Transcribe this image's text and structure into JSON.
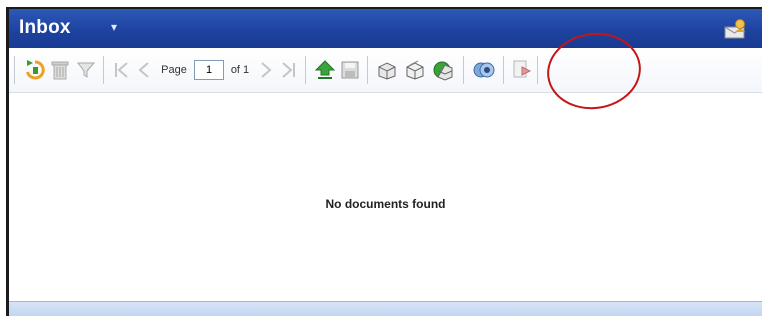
{
  "header": {
    "title": "Inbox",
    "title_caret": "▾",
    "title_icon": "envelope-user-icon"
  },
  "toolbar": {
    "page_label": "Page",
    "page_value": "1",
    "of_label": "of 1",
    "icons": [
      "refresh-icon",
      "delete-icon",
      "filter-icon",
      "first-page-icon",
      "previous-page-icon",
      "next-page-icon",
      "last-page-icon",
      "upload-icon",
      "save-icon",
      "package-icon",
      "package-alt-icon",
      "package-green-icon",
      "view-icon",
      "export-icon"
    ]
  },
  "content": {
    "empty_message": "No documents found"
  },
  "colors": {
    "titlebar": "#1e43a0",
    "highlight": "#c41616",
    "footer": "#c3d6f0"
  }
}
